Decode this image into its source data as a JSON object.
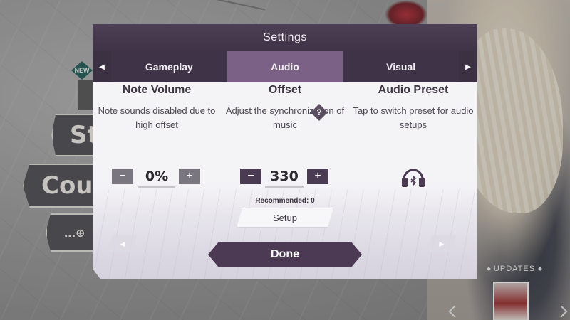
{
  "background": {
    "menu": {
      "new_badge": "NEW",
      "story_label": "St",
      "course_label": "Cours",
      "other_label": "…⊕"
    },
    "updates_label": "UPDATES"
  },
  "settings": {
    "title": "Settings",
    "tabs": [
      {
        "label": "Gameplay",
        "active": false
      },
      {
        "label": "Audio",
        "active": true
      },
      {
        "label": "Visual",
        "active": false
      }
    ],
    "note_volume": {
      "title": "Note Volume",
      "description": "Note sounds disabled due to high offset",
      "value": "0%",
      "decrement": "−",
      "increment": "+"
    },
    "offset": {
      "title": "Offset",
      "help": "?",
      "description": "Adjust the synchronization of music",
      "value": "330",
      "decrement": "−",
      "increment": "+",
      "recommended": "Recommended: 0",
      "setup_label": "Setup"
    },
    "audio_preset": {
      "title": "Audio Preset",
      "description": "Tap to switch preset for audio setups",
      "icon": "bluetooth-headphones-icon"
    },
    "done_label": "Done",
    "colors": {
      "header": "#4d3f55",
      "tab_active": "#7a6185",
      "accent_dark": "#4c3a55"
    }
  }
}
